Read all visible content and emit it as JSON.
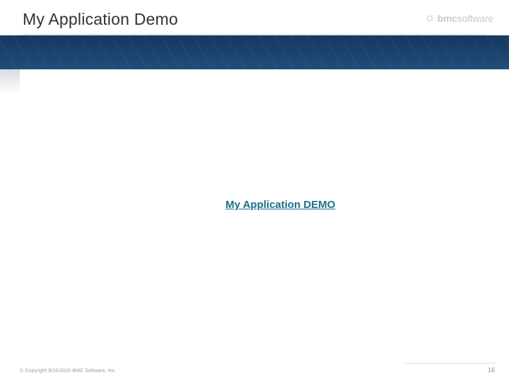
{
  "slide": {
    "title": "My Application Demo",
    "logo": {
      "bold": "bmc",
      "light": "software"
    },
    "link_text": "My Application DEMO",
    "footer": {
      "copyright": "© Copyright 9/15/2020 BMC Software, Inc.",
      "page_number": "16"
    }
  }
}
